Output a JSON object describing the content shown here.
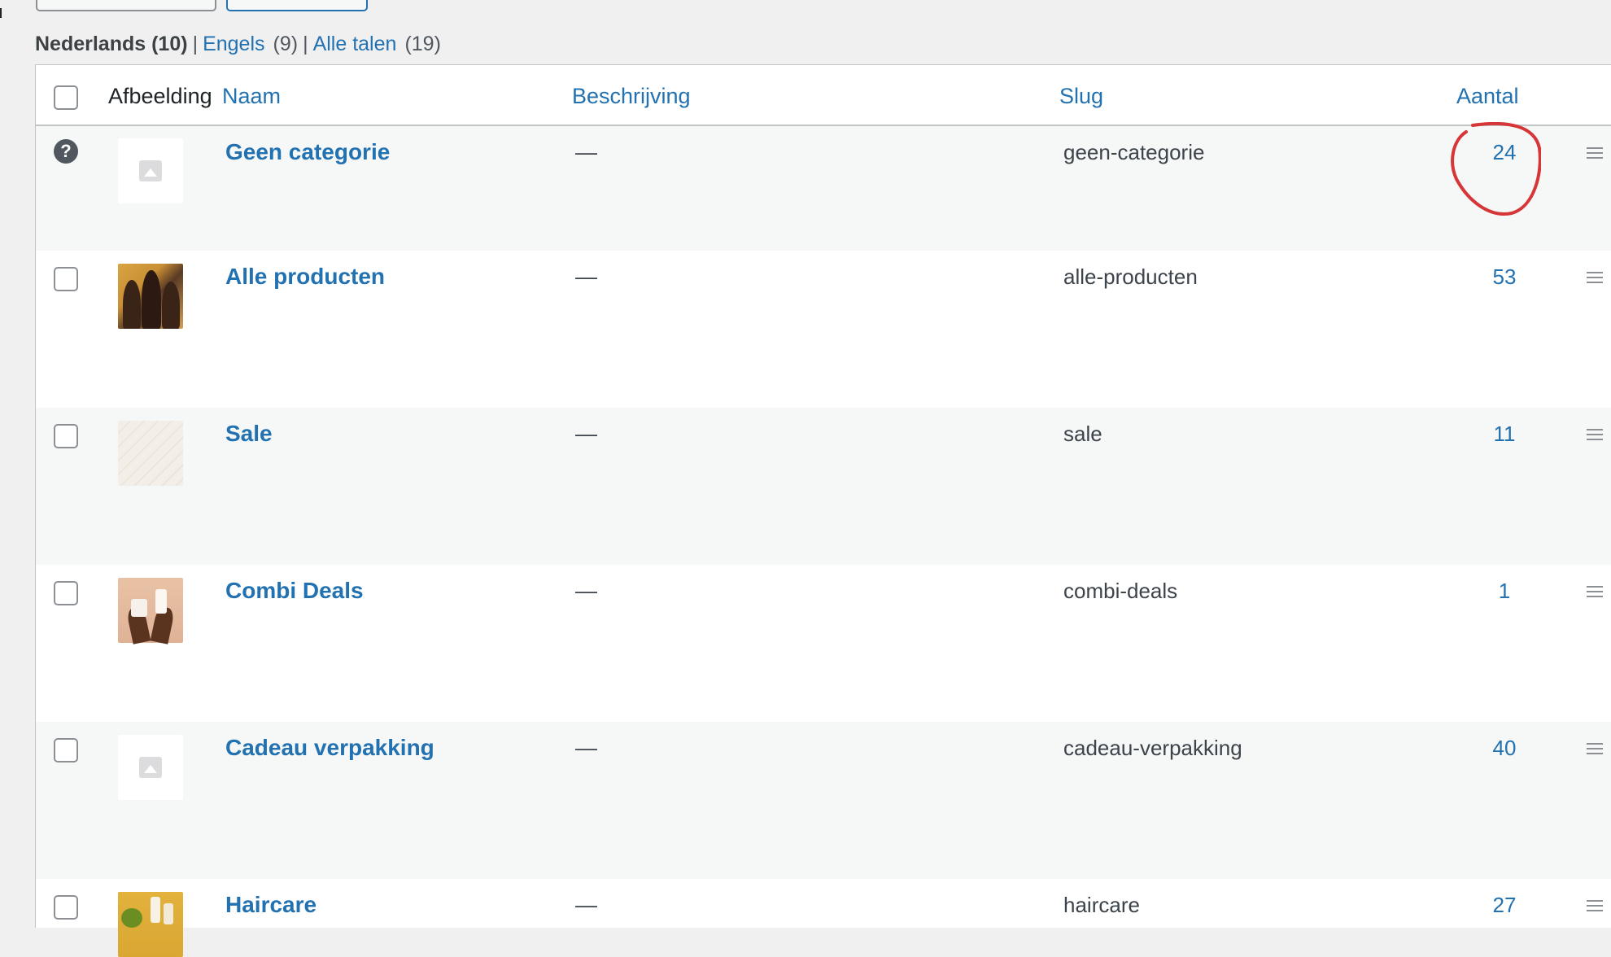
{
  "language_filter": {
    "current": "Nederlands (10)",
    "separator": "|",
    "links": [
      {
        "label": "Engels",
        "count": "(9)"
      },
      {
        "label": "Alle talen",
        "count": "(19)"
      }
    ]
  },
  "table": {
    "columns": {
      "image": "Afbeelding",
      "name": "Naam",
      "description": "Beschrijving",
      "slug": "Slug",
      "count": "Aantal"
    },
    "rows": [
      {
        "name": "Geen categorie",
        "description": "—",
        "slug": "geen-categorie",
        "count": "24",
        "thumb": "placeholder-icon",
        "default": true
      },
      {
        "name": "Alle producten",
        "description": "—",
        "slug": "alle-producten",
        "count": "53",
        "thumb": "group-photo"
      },
      {
        "name": "Sale",
        "description": "—",
        "slug": "sale",
        "count": "11",
        "thumb": "pattern-image"
      },
      {
        "name": "Combi Deals",
        "description": "—",
        "slug": "combi-deals",
        "count": "1",
        "thumb": "product-in-hands-photo"
      },
      {
        "name": "Cadeau verpakking",
        "description": "—",
        "slug": "cadeau-verpakking",
        "count": "40",
        "thumb": "placeholder-icon"
      },
      {
        "name": "Haircare",
        "description": "—",
        "slug": "haircare",
        "count": "27",
        "thumb": "haircare-products-photo"
      }
    ]
  },
  "colors": {
    "link": "#2271b1",
    "annotation": "#d63638",
    "row_alt": "#f6f7f7"
  }
}
